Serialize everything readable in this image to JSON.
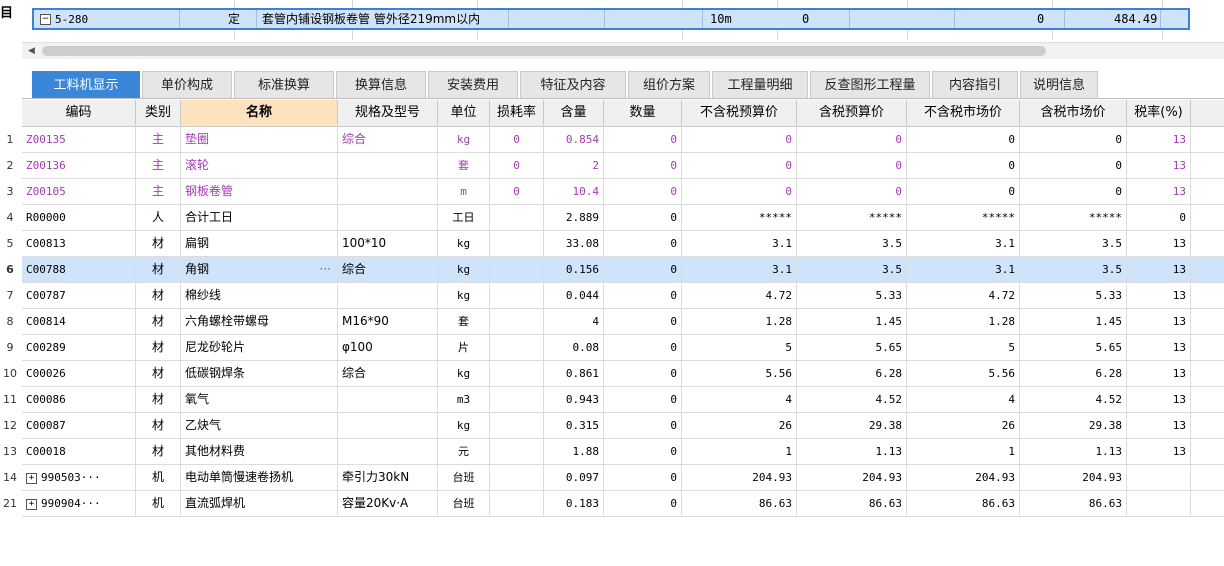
{
  "left_label": "目",
  "top_row": {
    "code": "5-280",
    "type": "定",
    "name": "套管内铺设钢板卷管 管外径219mm以内",
    "unit": "10m",
    "qty": "0",
    "val1": "0",
    "val2": "484.49"
  },
  "tabs": [
    "工料机显示",
    "单价构成",
    "标准换算",
    "换算信息",
    "安装费用",
    "特征及内容",
    "组价方案",
    "工程量明细",
    "反查图形工程量",
    "内容指引",
    "说明信息"
  ],
  "active_tab": 0,
  "columns": [
    "编码",
    "类别",
    "名称",
    "规格及型号",
    "单位",
    "损耗率",
    "含量",
    "数量",
    "不含税预算价",
    "含税预算价",
    "不含税市场价",
    "含税市场价",
    "税率(%)"
  ],
  "rows": [
    {
      "idx": "1",
      "code": "Z00135",
      "cat": "主",
      "name": "垫圈",
      "spec": "综合",
      "unit": "kg",
      "loss": "0",
      "amt": "0.854",
      "qty": "0",
      "p1": "0",
      "p2": "0",
      "p3": "0",
      "p4": "0",
      "tax": "13",
      "purple": true
    },
    {
      "idx": "2",
      "code": "Z00136",
      "cat": "主",
      "name": "滚轮",
      "spec": "",
      "unit": "套",
      "loss": "0",
      "amt": "2",
      "qty": "0",
      "p1": "0",
      "p2": "0",
      "p3": "0",
      "p4": "0",
      "tax": "13",
      "purple": true
    },
    {
      "idx": "3",
      "code": "Z00105",
      "cat": "主",
      "name": "钢板卷管",
      "spec": "",
      "unit": "m",
      "loss": "0",
      "amt": "10.4",
      "qty": "0",
      "p1": "0",
      "p2": "0",
      "p3": "0",
      "p4": "0",
      "tax": "13",
      "purple": true
    },
    {
      "idx": "4",
      "code": "R00000",
      "cat": "人",
      "name": "合计工日",
      "spec": "",
      "unit": "工日",
      "loss": "",
      "amt": "2.889",
      "qty": "0",
      "p1": "*****",
      "p2": "*****",
      "p3": "*****",
      "p4": "*****",
      "tax": "0"
    },
    {
      "idx": "5",
      "code": "C00813",
      "cat": "材",
      "name": "扁钢",
      "spec": "100*10",
      "unit": "kg",
      "loss": "",
      "amt": "33.08",
      "qty": "0",
      "p1": "3.1",
      "p2": "3.5",
      "p3": "3.1",
      "p4": "3.5",
      "tax": "13"
    },
    {
      "idx": "6",
      "code": "C00788",
      "cat": "材",
      "name": "角钢",
      "spec": "综合",
      "unit": "kg",
      "loss": "",
      "amt": "0.156",
      "qty": "0",
      "p1": "3.1",
      "p2": "3.5",
      "p3": "3.1",
      "p4": "3.5",
      "tax": "13",
      "selected": true
    },
    {
      "idx": "7",
      "code": "C00787",
      "cat": "材",
      "name": "棉纱线",
      "spec": "",
      "unit": "kg",
      "loss": "",
      "amt": "0.044",
      "qty": "0",
      "p1": "4.72",
      "p2": "5.33",
      "p3": "4.72",
      "p4": "5.33",
      "tax": "13"
    },
    {
      "idx": "8",
      "code": "C00814",
      "cat": "材",
      "name": "六角螺栓带螺母",
      "spec": "M16*90",
      "unit": "套",
      "loss": "",
      "amt": "4",
      "qty": "0",
      "p1": "1.28",
      "p2": "1.45",
      "p3": "1.28",
      "p4": "1.45",
      "tax": "13"
    },
    {
      "idx": "9",
      "code": "C00289",
      "cat": "材",
      "name": "尼龙砂轮片",
      "spec": "φ100",
      "unit": "片",
      "loss": "",
      "amt": "0.08",
      "qty": "0",
      "p1": "5",
      "p2": "5.65",
      "p3": "5",
      "p4": "5.65",
      "tax": "13"
    },
    {
      "idx": "10",
      "code": "C00026",
      "cat": "材",
      "name": "低碳钢焊条",
      "spec": "综合",
      "unit": "kg",
      "loss": "",
      "amt": "0.861",
      "qty": "0",
      "p1": "5.56",
      "p2": "6.28",
      "p3": "5.56",
      "p4": "6.28",
      "tax": "13"
    },
    {
      "idx": "11",
      "code": "C00086",
      "cat": "材",
      "name": "氧气",
      "spec": "",
      "unit": "m3",
      "loss": "",
      "amt": "0.943",
      "qty": "0",
      "p1": "4",
      "p2": "4.52",
      "p3": "4",
      "p4": "4.52",
      "tax": "13"
    },
    {
      "idx": "12",
      "code": "C00087",
      "cat": "材",
      "name": "乙炔气",
      "spec": "",
      "unit": "kg",
      "loss": "",
      "amt": "0.315",
      "qty": "0",
      "p1": "26",
      "p2": "29.38",
      "p3": "26",
      "p4": "29.38",
      "tax": "13"
    },
    {
      "idx": "13",
      "code": "C00018",
      "cat": "材",
      "name": "其他材料费",
      "spec": "",
      "unit": "元",
      "loss": "",
      "amt": "1.88",
      "qty": "0",
      "p1": "1",
      "p2": "1.13",
      "p3": "1",
      "p4": "1.13",
      "tax": "13"
    },
    {
      "idx": "14",
      "code": "990503···",
      "cat": "机",
      "name": "电动单筒慢速卷扬机",
      "spec": "牵引力30kN",
      "unit": "台班",
      "loss": "",
      "amt": "0.097",
      "qty": "0",
      "p1": "204.93",
      "p2": "204.93",
      "p3": "204.93",
      "p4": "204.93",
      "tax": "",
      "expand": true
    },
    {
      "idx": "21",
      "code": "990904···",
      "cat": "机",
      "name": "直流弧焊机",
      "spec": "容量20Kv·A",
      "unit": "台班",
      "loss": "",
      "amt": "0.183",
      "qty": "0",
      "p1": "86.63",
      "p2": "86.63",
      "p3": "86.63",
      "p4": "86.63",
      "tax": "",
      "expand": true
    }
  ]
}
